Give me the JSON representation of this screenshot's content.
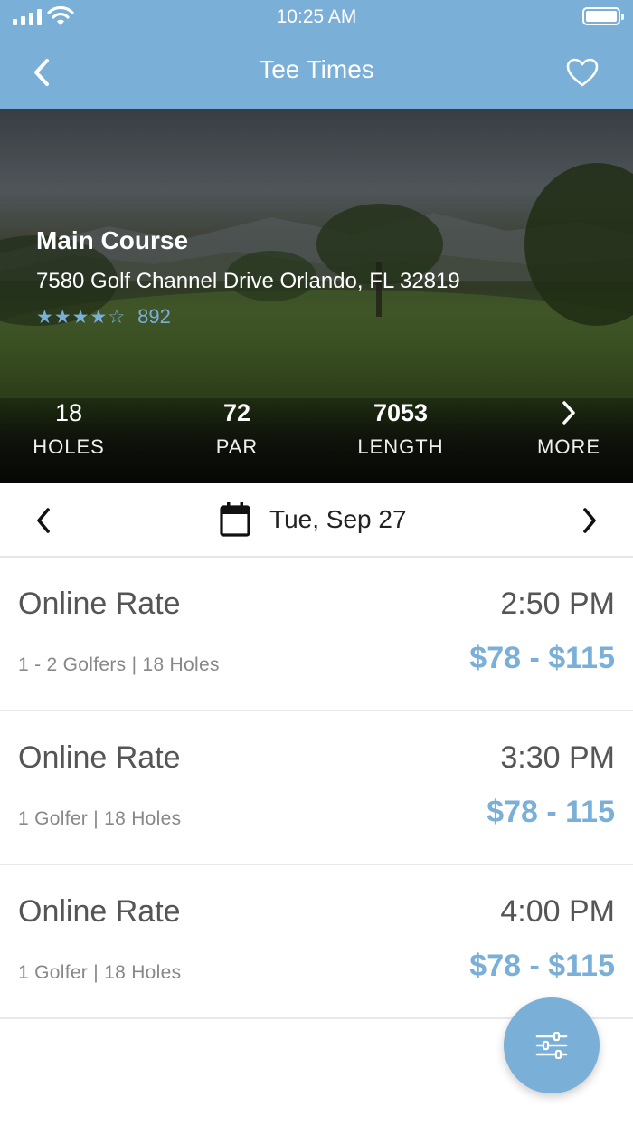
{
  "status_bar": {
    "time": "10:25 AM"
  },
  "nav": {
    "title": "Tee Times",
    "back_icon": "chevron-left-icon",
    "favorite_icon": "heart-icon"
  },
  "course": {
    "name": "Main Course",
    "address": "7580 Golf Channel Drive Orlando, FL 32819",
    "rating_stars": 4,
    "rating_max": 5,
    "review_count": "892"
  },
  "stats": [
    {
      "value": "18",
      "label": "HOLES"
    },
    {
      "value": "72",
      "label": "PAR"
    },
    {
      "value": "7053",
      "label": "LENGTH"
    },
    {
      "value": "",
      "label": "MORE"
    }
  ],
  "date_bar": {
    "date": "Tue, Sep 27"
  },
  "tee_times": [
    {
      "rate": "Online Rate",
      "time": "2:50 PM",
      "details": "1 - 2 Golfers | 18 Holes",
      "price": "$78 - $115"
    },
    {
      "rate": "Online Rate",
      "time": "3:30 PM",
      "details": "1 Golfer | 18 Holes",
      "price": "$78 - 115"
    },
    {
      "rate": "Online Rate",
      "time": "4:00 PM",
      "details": "1 Golfer | 18 Holes",
      "price": "$78 - $115"
    }
  ],
  "colors": {
    "accent": "#7aafd7",
    "text_dark": "#555555",
    "text_muted": "#888888"
  },
  "fab": {
    "icon": "filter-sliders-icon"
  }
}
